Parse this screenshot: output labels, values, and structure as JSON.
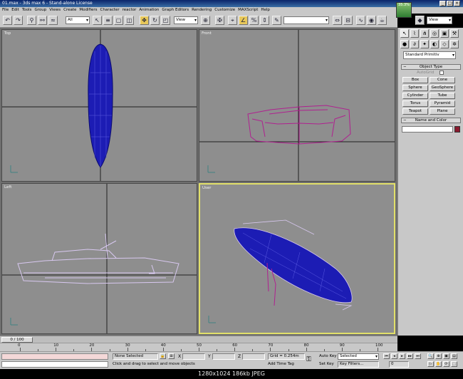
{
  "window": {
    "title": "01.max - 3ds max 6 - Stand-alone License",
    "controls": [
      "_",
      "□",
      "×"
    ]
  },
  "menu": [
    "File",
    "Edit",
    "Tools",
    "Group",
    "Views",
    "Create",
    "Modifiers",
    "Character",
    "reactor",
    "Animation",
    "Graph Editors",
    "Rendering",
    "Customize",
    "MAXScript",
    "Help"
  ],
  "toolbar": {
    "selection_filter": "All",
    "ref_coord": "View",
    "right_dropdown": "View",
    "logo_text": "35.3%"
  },
  "viewports": [
    {
      "label": "Top",
      "active": false
    },
    {
      "label": "Front",
      "active": false
    },
    {
      "label": "Left",
      "active": false
    },
    {
      "label": "User",
      "active": true
    }
  ],
  "command_panel": {
    "category_dropdown": "Standard Primitiv",
    "object_type_header": "Object Type",
    "autogrid_label": "AutoGrid",
    "buttons": [
      "Box",
      "Cone",
      "Sphere",
      "GeoSphere",
      "Cylinder",
      "Tube",
      "Torus",
      "Pyramid",
      "Teapot",
      "Plane"
    ],
    "name_color_header": "Name and Color",
    "object_color": "#8b1a2e"
  },
  "time": {
    "slider": "0 / 100",
    "ticks": [
      "0",
      "10",
      "20",
      "30",
      "40",
      "50",
      "60",
      "70",
      "80",
      "90",
      "100"
    ]
  },
  "status": {
    "selection": "None Selected",
    "prompt": "Click and drag to select and move objects",
    "x_label": "X",
    "y_label": "Y",
    "z_label": "Z",
    "grid": "Grid = 0.254m",
    "add_time_tag": "Add Time Tag",
    "auto_key": "Auto Key",
    "set_key": "Set Key",
    "key_mode": "Selected",
    "key_filters": "Key Filters...",
    "frame": "0"
  },
  "colors": {
    "wire_blue": "#1c1cb4",
    "wire_magenta": "#b02090",
    "wire_lilac": "#d8c8f0",
    "active_border": "#e2e06a"
  },
  "caption": "1280x1024  186kb  JPEG"
}
